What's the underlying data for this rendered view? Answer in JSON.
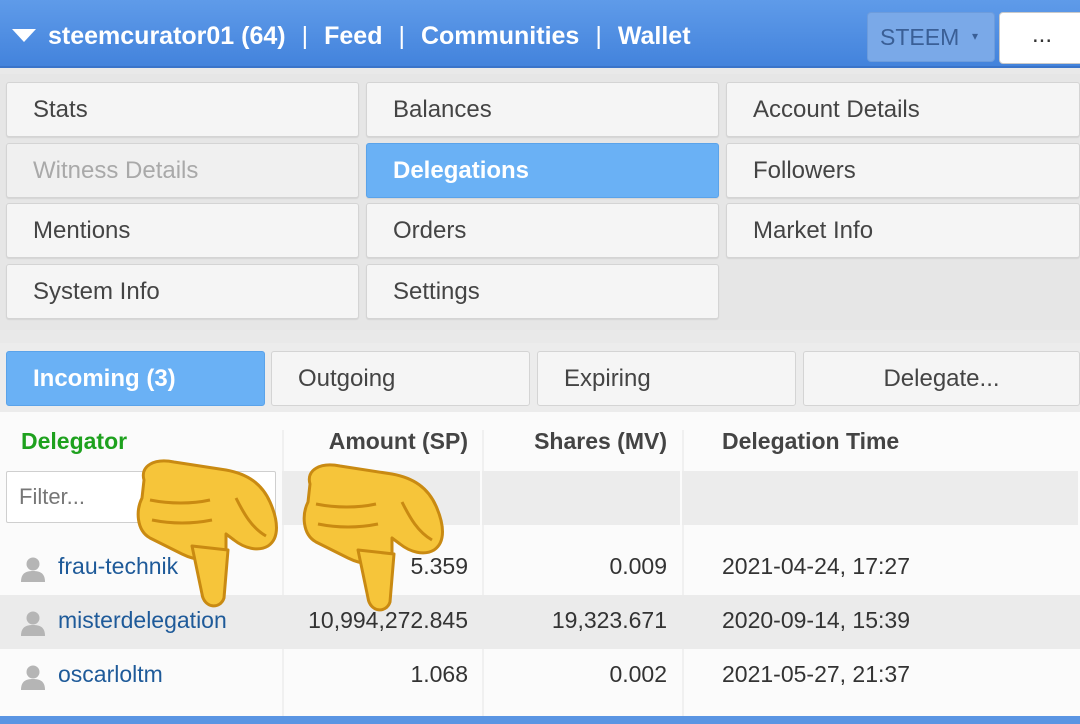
{
  "header": {
    "account": "steemcurator01 (64)",
    "separator": "|",
    "nav": [
      "Feed",
      "Communities",
      "Wallet"
    ],
    "currency_select": "STEEM",
    "currency_arrow": "▾",
    "more_label": "..."
  },
  "menu": {
    "stats": "Stats",
    "balances": "Balances",
    "account_details": "Account Details",
    "witness_details": "Witness Details",
    "delegations": "Delegations",
    "followers": "Followers",
    "mentions": "Mentions",
    "orders": "Orders",
    "market_info": "Market Info",
    "system_info": "System Info",
    "settings": "Settings"
  },
  "tabs": {
    "incoming": "Incoming (3)",
    "outgoing": "Outgoing",
    "expiring": "Expiring",
    "delegate": "Delegate..."
  },
  "table": {
    "headers": {
      "delegator": "Delegator",
      "amount": "Amount (SP)",
      "shares": "Shares (MV)",
      "time": "Delegation Time"
    },
    "filter_placeholder": "Filter...",
    "rows": [
      {
        "delegator": "frau-technik",
        "amount": "5.359",
        "shares": "0.009",
        "time": "2021-04-24, 17:27"
      },
      {
        "delegator": "misterdelegation",
        "amount": "10,994,272.845",
        "shares": "19,323.671",
        "time": "2020-09-14, 15:39"
      },
      {
        "delegator": "oscarloltm",
        "amount": "1.068",
        "shares": "0.002",
        "time": "2021-05-27, 21:37"
      }
    ]
  },
  "colors": {
    "header_blue": "#4a8ae0",
    "active_blue": "#6ab1f5",
    "delegator_green": "#1ea11e",
    "link_blue": "#1e5a99"
  },
  "icons": [
    "chevron-down-icon",
    "user-icon",
    "pointing-down-hand-icon"
  ]
}
